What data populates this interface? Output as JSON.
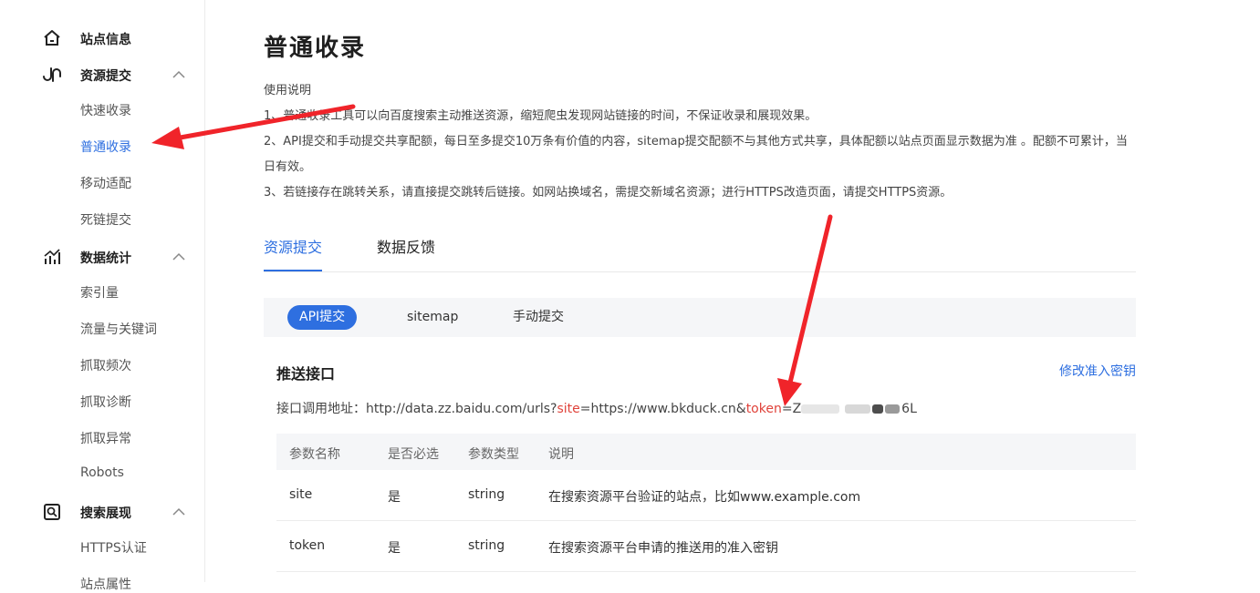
{
  "sidebar": {
    "site_info": "站点信息",
    "resource_submit": "资源提交",
    "quick_index": "快速收录",
    "normal_index": "普通收录",
    "mobile_adapt": "移动适配",
    "dead_link": "死链提交",
    "data_stats": "数据统计",
    "index_count": "索引量",
    "traffic_keywords": "流量与关键词",
    "crawl_freq": "抓取频次",
    "crawl_diag": "抓取诊断",
    "crawl_errors": "抓取异常",
    "robots": "Robots",
    "search_display": "搜索展现",
    "https_auth": "HTTPS认证",
    "site_attr": "站点属性"
  },
  "main": {
    "title": "普通收录",
    "desc_heading": "使用说明",
    "desc_1": "1、普通收录工具可以向百度搜索主动推送资源，缩短爬虫发现网站链接的时间，不保证收录和展现效果。",
    "desc_2": "2、API提交和手动提交共享配额，每日至多提交10万条有价值的内容，sitemap提交配额不与其他方式共享，具体配额以站点页面显示数据为准 。配额不可累计，当日有效。",
    "desc_3": "3、若链接存在跳转关系，请直接提交跳转后链接。如网站换域名，需提交新域名资源；进行HTTPS改造页面，请提交HTTPS资源。",
    "tabs": [
      "资源提交",
      "数据反馈"
    ],
    "subtabs": [
      "API提交",
      "sitemap",
      "手动提交"
    ],
    "section_title": "推送接口",
    "modify_key": "修改准入密钥",
    "url_label": "接口调用地址：",
    "url_prefix": "http://data.zz.baidu.com/urls?",
    "url_site_key": "site",
    "url_site_val": "=https://www.bkduck.cn&",
    "url_token_key": "token",
    "url_token_start": "=Z",
    "url_token_end": "6L",
    "table": {
      "headers": [
        "参数名称",
        "是否必选",
        "参数类型",
        "说明"
      ],
      "rows": [
        [
          "site",
          "是",
          "string",
          "在搜索资源平台验证的站点，比如www.example.com"
        ],
        [
          "token",
          "是",
          "string",
          "在搜索资源平台申请的推送用的准入密钥"
        ]
      ]
    }
  },
  "colors": {
    "accent": "#2e6fe0",
    "param_red": "#e0433b",
    "annotation_arrow": "#f0242a"
  }
}
